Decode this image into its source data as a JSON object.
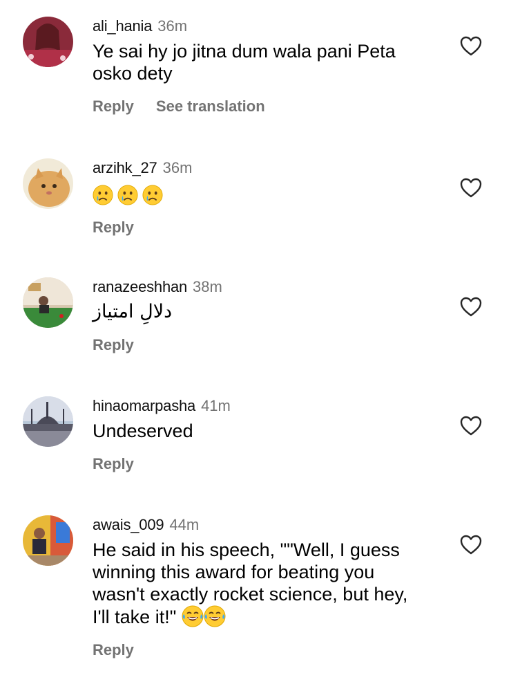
{
  "comments": [
    {
      "username": "ali_hania",
      "time": "36m",
      "text_line1": "Ye sai hy jo jitna dum wala pani Peta",
      "text_line2": "osko dety",
      "reply_label": "Reply",
      "translate_label": "See translation"
    },
    {
      "username": "arzihk_27",
      "time": "36m",
      "emojis": [
        "crying-face",
        "crying-face",
        "crying-face"
      ],
      "reply_label": "Reply"
    },
    {
      "username": "ranazeeshhan",
      "time": "38m",
      "text": "دلالِ امتیاز",
      "reply_label": "Reply"
    },
    {
      "username": "hinaomarpasha",
      "time": "41m",
      "text": "Undeserved",
      "reply_label": "Reply"
    },
    {
      "username": "awais_009",
      "time": "44m",
      "text_line1": "He said in his speech, \"\"Well, I guess",
      "text_line2": "winning this award for beating you",
      "text_line3": "wasn't exactly rocket science, but hey,",
      "text_line4": "I'll take it!\"",
      "trailing_emojis": [
        "tears-of-joy",
        "tears-of-joy"
      ],
      "reply_label": "Reply"
    }
  ],
  "icons": {
    "like": "heart-outline-icon"
  },
  "colors": {
    "username": "#111111",
    "muted": "#737373",
    "text": "#000000"
  }
}
